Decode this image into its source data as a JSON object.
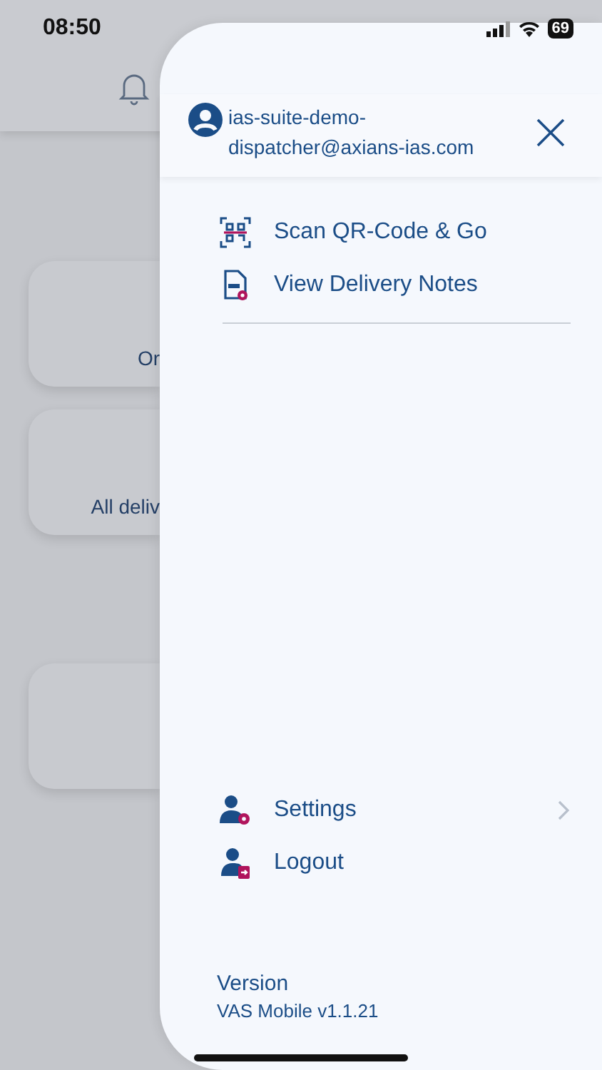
{
  "status_bar": {
    "time": "08:50",
    "battery": "69"
  },
  "background": {
    "cards": [
      {
        "kind": "labelled",
        "label": "Or"
      },
      {
        "kind": "labelled",
        "label": "All deliv"
      },
      {
        "kind": "empty"
      }
    ]
  },
  "drawer": {
    "user": "ias-suite-demo-dispatcher@axians-ias.com",
    "menu": [
      {
        "kind": "qr",
        "label": "Scan QR-Code & Go"
      },
      {
        "kind": "notes",
        "label": "View Delivery Notes"
      }
    ],
    "bottom_menu": [
      {
        "kind": "settings",
        "label": "Settings",
        "chevron": true
      },
      {
        "kind": "logout",
        "label": "Logout",
        "chevron": false
      }
    ],
    "version_label": "Version",
    "version": "VAS Mobile v1.1.21"
  }
}
